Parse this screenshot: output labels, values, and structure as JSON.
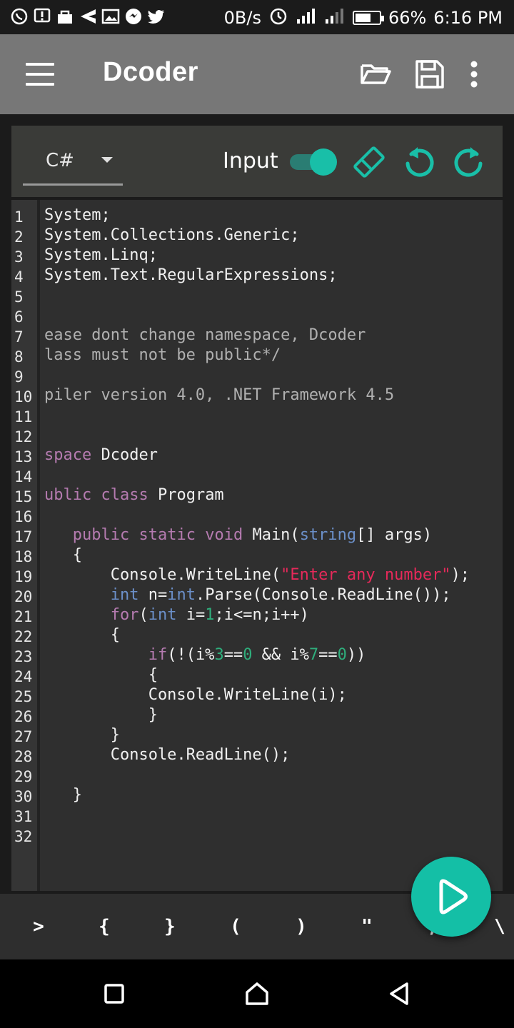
{
  "status_bar": {
    "net_speed": "0B/s",
    "battery_pct": "66%",
    "battery_level": 0.66,
    "time": "6:16 PM",
    "icons": [
      "whatsapp-icon",
      "alert-icon",
      "bag-icon",
      "send-icon",
      "image-icon",
      "chat-icon",
      "twitter-icon",
      "alarm-icon",
      "signal-icon",
      "signal-icon-2",
      "battery-icon"
    ]
  },
  "appbar": {
    "title": "Dcoder",
    "icons": [
      "menu-icon",
      "folder-open-icon",
      "save-icon",
      "more-vert-icon"
    ]
  },
  "toolbar": {
    "language": "C#",
    "input_label": "Input",
    "input_toggle_on": true,
    "icons": [
      "eraser-icon",
      "undo-icon",
      "redo-icon"
    ],
    "accent": "#19bfa8"
  },
  "editor": {
    "line_numbers": [
      "1",
      "2",
      "3",
      "4",
      "5",
      "6",
      "7",
      "8",
      "9",
      "10",
      "11",
      "12",
      "13",
      "14",
      "15",
      "16",
      "17",
      "18",
      "19",
      "20",
      "21",
      "22",
      "23",
      "24",
      "25",
      "26",
      "27",
      "28",
      "29",
      "30",
      "31",
      "32"
    ]
  },
  "keybar": {
    "keys": [
      ">",
      "{",
      "}",
      "(",
      ")",
      "\"",
      ";",
      "\\"
    ]
  },
  "navbar": {
    "icons": [
      "recents-square-icon",
      "home-icon",
      "back-icon"
    ]
  }
}
